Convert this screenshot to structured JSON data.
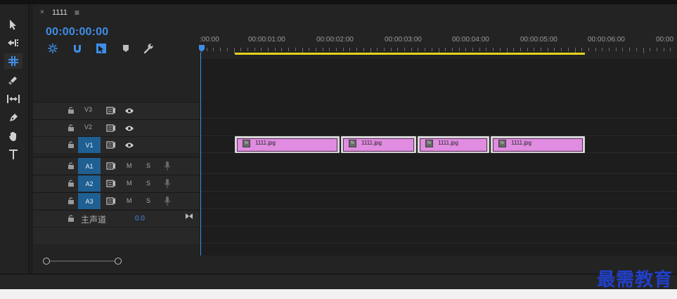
{
  "tab": {
    "title": "1111",
    "close_glyph": "×",
    "menu_glyph": "≡"
  },
  "timecode": "00:00:00:00",
  "ruler_labels": [
    ":00:00",
    "00:00:01:00",
    "00:00:02:00",
    "00:00:03:00",
    "00:00:04:00",
    "00:00:05:00",
    "00:00:06:00",
    "00:00"
  ],
  "tools": [
    "selection-tool-icon",
    "track-select-icon",
    "ripple-edit-icon",
    "razor-icon",
    "slip-icon",
    "pen-icon",
    "hand-icon",
    "type-icon"
  ],
  "tracks": {
    "video": [
      {
        "label": "V3",
        "selected": false
      },
      {
        "label": "V2",
        "selected": false
      },
      {
        "label": "V1",
        "selected": true
      }
    ],
    "audio": [
      {
        "label": "A1",
        "m": "M",
        "s": "S",
        "selected": true
      },
      {
        "label": "A2",
        "m": "M",
        "s": "S",
        "selected": true
      },
      {
        "label": "A3",
        "m": "M",
        "s": "S",
        "selected": true
      }
    ],
    "master": {
      "label": "主声道",
      "value": "0.0"
    }
  },
  "clips": [
    {
      "name": "1111.jpg"
    },
    {
      "name": "1111.jpg"
    },
    {
      "name": "1111.jpg"
    },
    {
      "name": "1111.jpg"
    }
  ],
  "watermark": "最需教育",
  "colors": {
    "accent": "#3f8ee6",
    "clip": "#e08ce0",
    "work_area": "#e5d21e",
    "selected_track": "#1f5f92"
  }
}
